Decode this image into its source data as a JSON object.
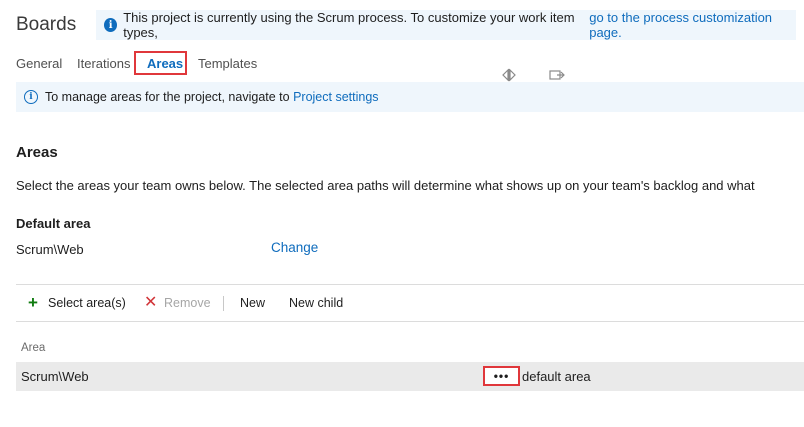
{
  "header": {
    "title": "Boards",
    "process_banner": {
      "icon": "info-icon",
      "text": "This project is currently using the Scrum process. To customize your work item types,",
      "link": "go to the process customization page."
    }
  },
  "tabs": [
    {
      "label": "General",
      "active": false
    },
    {
      "label": "Iterations",
      "active": false
    },
    {
      "label": "Areas",
      "active": true
    },
    {
      "label": "Templates",
      "active": false
    }
  ],
  "project_banner": {
    "icon": "info-icon",
    "text": "To manage areas for the project, navigate to",
    "link": "Project settings"
  },
  "areas": {
    "heading": "Areas",
    "description": "Select the areas your team owns below. The selected area paths will determine what shows up on your team's backlog and what",
    "default_area_label": "Default area",
    "default_area_value": "Scrum\\Web",
    "change_link": "Change"
  },
  "toolbar": {
    "select_areas": "Select area(s)",
    "remove": "Remove",
    "new": "New",
    "new_child": "New child"
  },
  "table": {
    "column_header": "Area",
    "rows": [
      {
        "path": "Scrum\\Web",
        "more": "•••",
        "badge": "default area"
      }
    ]
  },
  "colors": {
    "accent": "#0f6cbd",
    "banner_bg": "#eff6fc",
    "highlight_box": "#e0373b",
    "add_green": "#107c10",
    "remove_red": "#d13438"
  }
}
